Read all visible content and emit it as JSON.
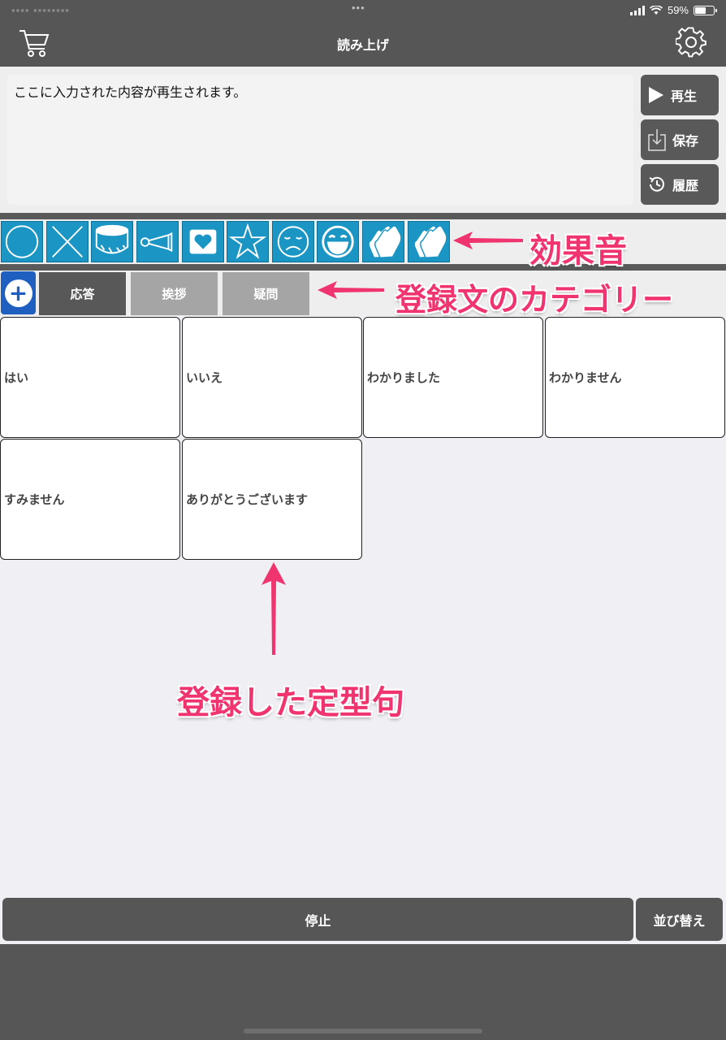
{
  "status_bar": {
    "left": "▪▪▪▪  ▪▪▪▪▪▪▪▪",
    "dots": "•••",
    "battery": "59%",
    "battery_level": 0.59
  },
  "header": {
    "title": "読み上げ",
    "left_icon": "cart-icon",
    "right_icon": "gear-icon"
  },
  "input": {
    "text": "ここに入力された内容が再生されます。"
  },
  "side_buttons": [
    {
      "label": "再生",
      "icon": "play-icon"
    },
    {
      "label": "保存",
      "icon": "download-icon"
    },
    {
      "label": "履歴",
      "icon": "history-icon"
    }
  ],
  "effects": [
    "circle-icon",
    "cross-icon",
    "drum-icon",
    "horn-icon",
    "heart-icon",
    "star-icon",
    "sad-face-icon",
    "laugh-face-icon",
    "clap-icon",
    "clap-icon"
  ],
  "categories": {
    "add_icon": "plus-icon",
    "tabs": [
      {
        "label": "応答",
        "active": true
      },
      {
        "label": "挨拶",
        "active": false
      },
      {
        "label": "疑問",
        "active": false
      }
    ]
  },
  "phrases": [
    "はい",
    "いいえ",
    "わかりました",
    "わかりません",
    "すみません",
    "ありがとうございます"
  ],
  "annotations": {
    "effects": "効果音",
    "categories": "登録文のカテゴリー",
    "phrases": "登録した定型句"
  },
  "bottom": {
    "stop": "停止",
    "sort": "並び替え"
  },
  "colors": {
    "bar": "#565656",
    "effect_tile": "#1a95c4",
    "add_button": "#1f5fbf",
    "annotation": "#f0346f"
  }
}
